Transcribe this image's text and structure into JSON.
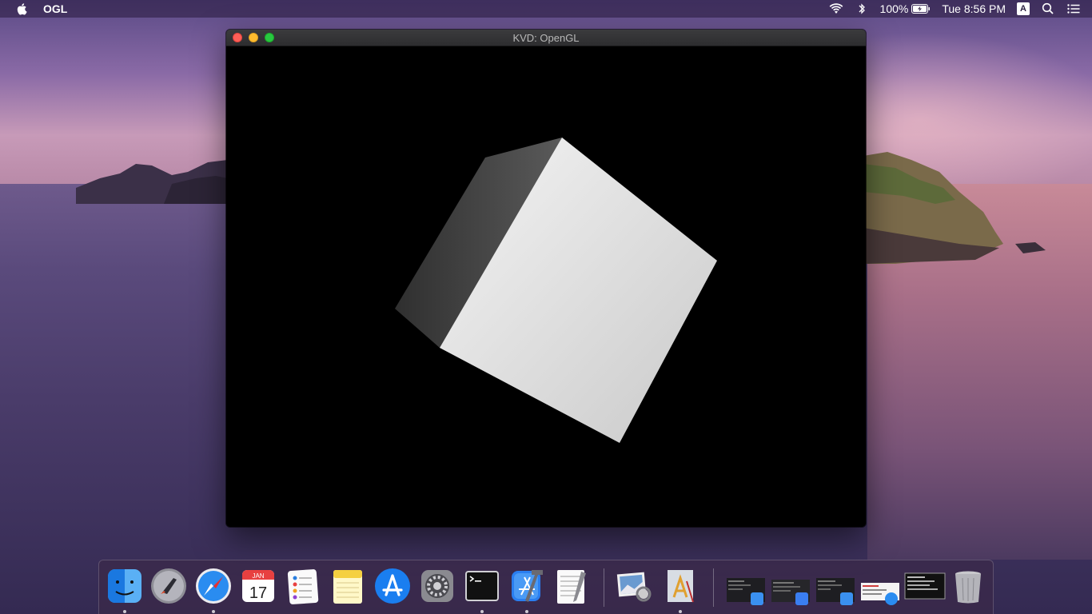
{
  "menubar": {
    "app_name": "OGL",
    "battery": "100%",
    "clock": "Tue 8:56 PM",
    "input_source": "A"
  },
  "window": {
    "title": "KVD: OpenGL"
  },
  "dock": {
    "apps": [
      "Finder",
      "Launchpad",
      "Safari",
      "Calendar",
      "Reminders",
      "Notes",
      "App Store",
      "System Preferences",
      "Terminal",
      "Xcode",
      "TextEdit",
      "Preview",
      "Instruments",
      "Trash"
    ],
    "calendar_month": "JAN",
    "calendar_day": "17"
  },
  "colors": {
    "close": "#fe5f57",
    "minimize": "#febc2e",
    "maximize": "#28c840"
  }
}
